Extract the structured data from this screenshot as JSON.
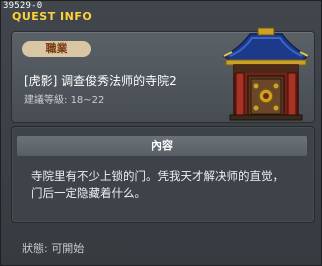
{
  "header": {
    "quest_id": "39529-0",
    "title": "QUEST INFO"
  },
  "quest": {
    "badge": "職業",
    "name": "[虎影] 调查俊秀法师的寺院2",
    "level_label": "建議等級",
    "level_sep": ": ",
    "level_range": "18~22"
  },
  "content": {
    "header": "內容",
    "line1": "寺院里有不少上锁的门。凭我天才解决师的直觉，",
    "line2": "门后一定隐藏着什么。"
  },
  "status": {
    "label": "狀態",
    "sep": ": ",
    "value": "可開始"
  },
  "icons": {
    "building": "temple-building-icon"
  },
  "colors": {
    "title": "#ffd23a",
    "badge_bg": "#d8c6a5",
    "badge_text": "#7a3b12",
    "roof": "#1d3a8a"
  }
}
